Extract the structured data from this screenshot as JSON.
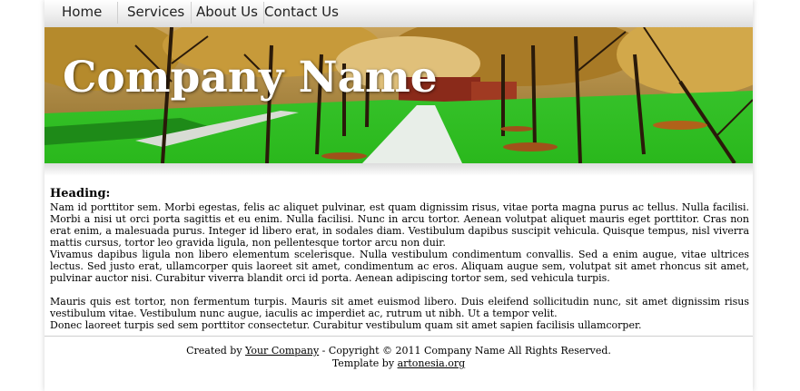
{
  "nav": {
    "items": [
      {
        "label": "Home"
      },
      {
        "label": "Services"
      },
      {
        "label": "About Us"
      },
      {
        "label": "Contact Us"
      }
    ]
  },
  "banner": {
    "title": "Company Name"
  },
  "content": {
    "heading": "Heading:",
    "paragraphs": [
      "Nam id porttitor sem. Morbi egestas, felis ac aliquet pulvinar, est quam dignissim risus, vitae porta magna purus ac tellus. Nulla facilisi. Morbi a nisi ut orci porta sagittis et eu enim. Nulla facilisi. Nunc in arcu tortor. Aenean volutpat aliquet mauris eget porttitor. Cras non erat enim, a malesuada purus. Integer id libero erat, in sodales diam. Vestibulum dapibus suscipit vehicula. Quisque tempus, nisl viverra mattis cursus, tortor leo gravida ligula, non pellentesque tortor arcu non duir.",
      "Vivamus dapibus ligula non libero elementum scelerisque. Nulla vestibulum condimentum convallis. Sed a enim augue, vitae ultrices lectus. Sed justo erat, ullamcorper quis laoreet sit amet, condimentum ac eros. Aliquam augue sem, volutpat sit amet rhoncus sit amet, pulvinar auctor nisi. Curabitur viverra blandit orci id porta. Aenean adipiscing tortor sem, sed vehicula turpis.",
      "Mauris quis est tortor, non fermentum turpis. Mauris sit amet euismod libero. Duis eleifend sollicitudin nunc, sit amet dignissim risus vestibulum vitae. Vestibulum nunc augue, iaculis ac imperdiet ac, rutrum ut nibh. Ut a tempor velit.",
      "Donec laoreet turpis sed sem porttitor consectetur. Curabitur vestibulum quam sit amet sapien facilisis ullamcorper."
    ]
  },
  "footer": {
    "created_prefix": "Created by ",
    "company_link": "Your Company",
    "copyright": " - Copyright © 2011 Company Name All Rights Reserved.",
    "template_prefix": "Template by ",
    "template_link": "artonesia.org"
  }
}
